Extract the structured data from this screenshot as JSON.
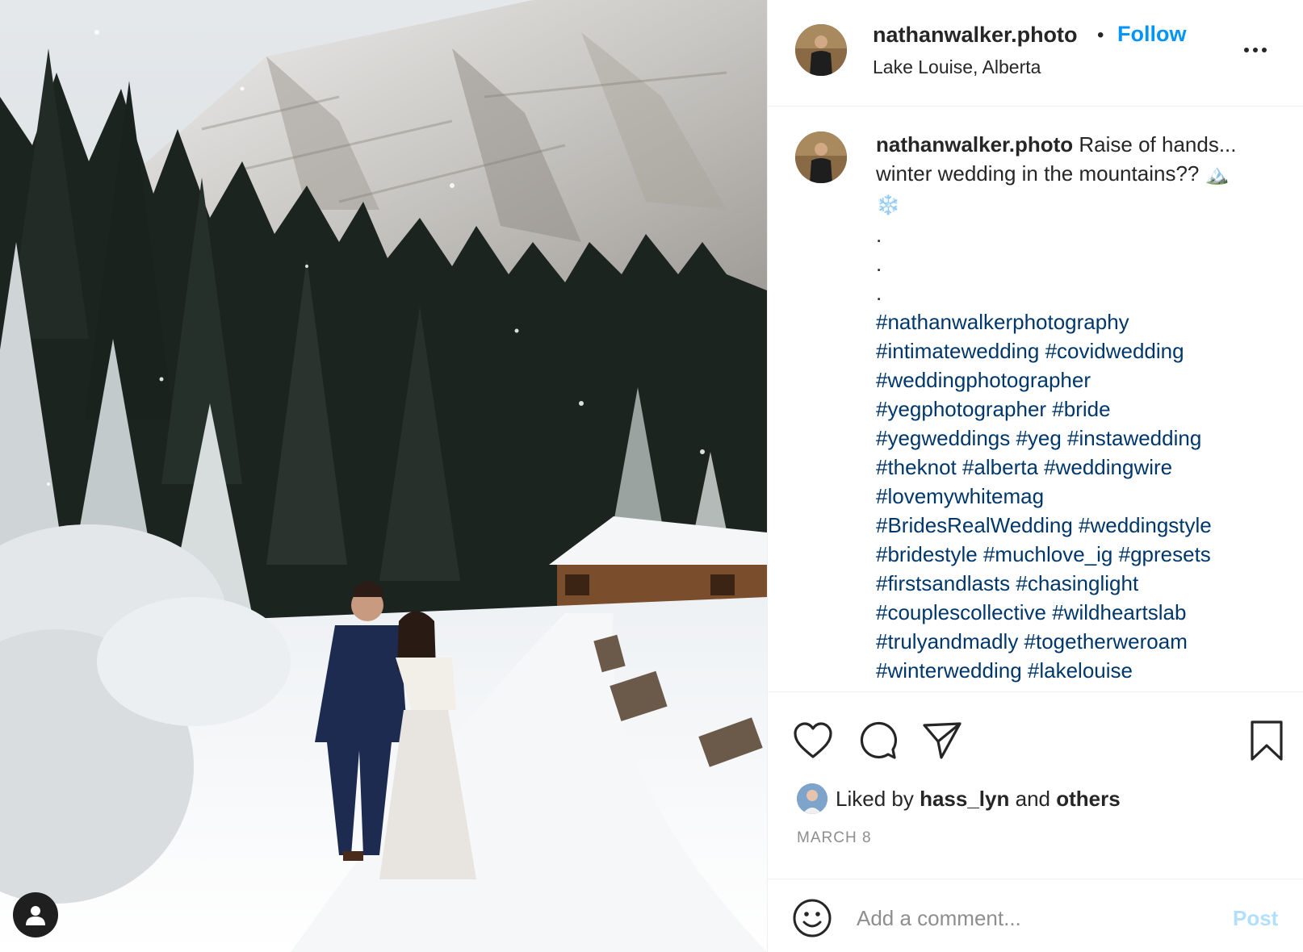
{
  "post": {
    "author": "nathanwalker.photo",
    "follow_label": "Follow",
    "separator": "•",
    "location": "Lake Louise, Alberta",
    "caption": {
      "username": "nathanwalker.photo",
      "line1": "Raise of hands...",
      "line2": "winter wedding in the mountains??",
      "emoji_mountain": "🏔️",
      "emoji_snowflake": "❄️",
      "dots": [
        ".",
        ".",
        "."
      ],
      "hashtag_lines": [
        "#nathanwalkerphotography",
        "#intimatewedding #covidwedding",
        "#weddingphotographer",
        "#yegphotographer #bride",
        "#yegweddings #yeg #instawedding",
        "#theknot #alberta #weddingwire",
        "#lovemywhitemag",
        "#BridesRealWedding #weddingstyle",
        "#bridestyle #muchlove_ig #gpresets",
        "#firstsandlasts #chasinglight",
        "#couplescollective #wildheartslab",
        "#trulyandmadly #togetherweroam",
        "#winterwedding #lakelouise"
      ]
    },
    "likes": {
      "prefix": "Liked by",
      "user": "hass_lyn",
      "joiner": "and",
      "others": "others"
    },
    "date": "MARCH 8",
    "comment": {
      "placeholder": "Add a comment...",
      "post_label": "Post"
    }
  },
  "icons": {
    "tag": "user-silhouette-icon",
    "more": "more-horizontal-icon",
    "like": "heart-outline-icon",
    "comment": "speech-bubble-icon",
    "share": "paper-plane-icon",
    "save": "bookmark-outline-icon",
    "emoji": "smiley-face-icon"
  },
  "colors": {
    "accent": "#0095f6",
    "hashtag": "#00376b",
    "muted": "#8e8e8e",
    "post_disabled": "#b2dffc"
  }
}
